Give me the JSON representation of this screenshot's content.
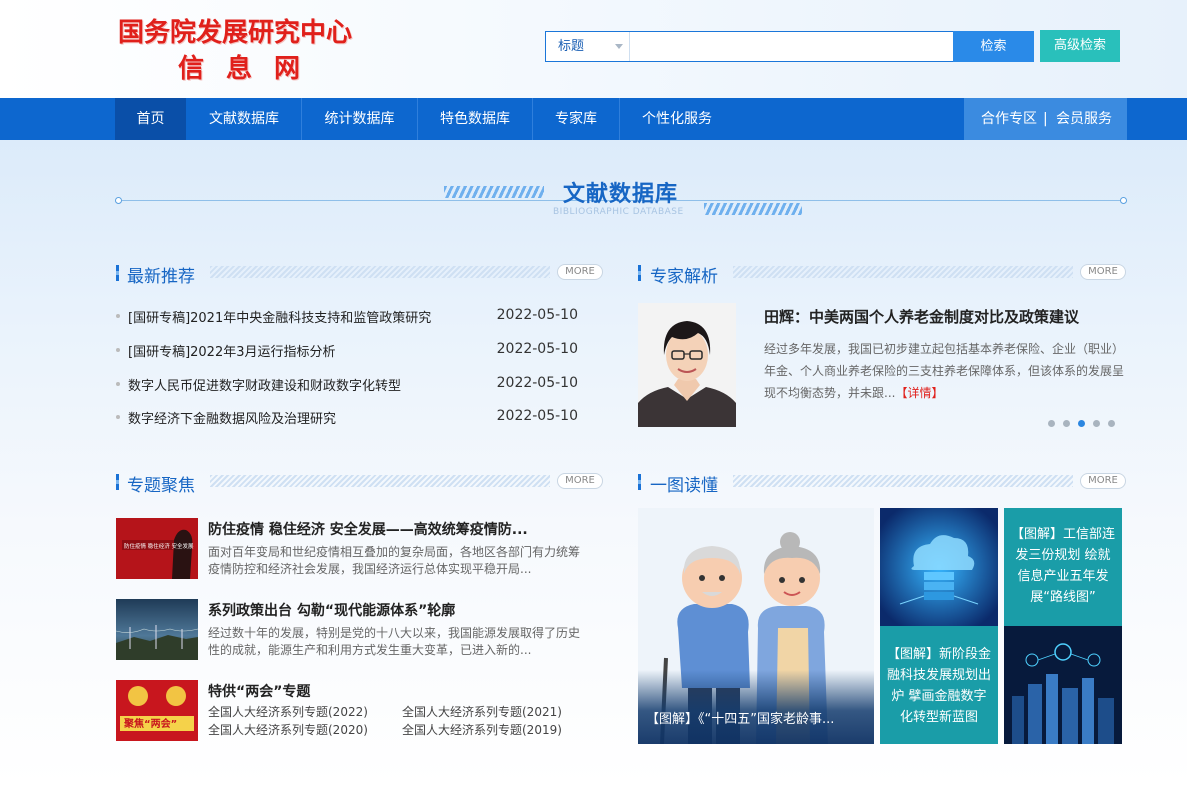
{
  "header": {
    "logo_line1": "国务院发展研究中心",
    "logo_line2": "信息网",
    "search": {
      "field": "标题",
      "placeholder": "",
      "button": "检索"
    },
    "advanced_search": "高级检索"
  },
  "nav": {
    "items": [
      "首页",
      "文献数据库",
      "统计数据库",
      "特色数据库",
      "专家库",
      "个性化服务"
    ],
    "right": [
      "合作专区",
      "会员服务"
    ],
    "divider": "|"
  },
  "section": {
    "title": "文献数据库",
    "subtitle": "BIBLIOGRAPHIC DATABASE"
  },
  "more_label": "MORE",
  "latest": {
    "title": "最新推荐",
    "items": [
      {
        "title": "[国研专稿]2021年中央金融科技支持和监管政策研究",
        "date": "2022-05-10"
      },
      {
        "title": "[国研专稿]2022年3月运行指标分析",
        "date": "2022-05-10"
      },
      {
        "title": "数字人民币促进数字财政建设和财政数字化转型",
        "date": "2022-05-10"
      },
      {
        "title": "数字经济下金融数据风险及治理研究",
        "date": "2022-05-10"
      }
    ]
  },
  "expert": {
    "title": "专家解析",
    "headline": "田辉：中美两国个人养老金制度对比及政策建议",
    "desc": "经过多年发展，我国已初步建立起包括基本养老保险、企业（职业）年金、个人商业养老保险的三支柱养老保障体系，但该体系的发展呈现不均衡态势，并未跟...",
    "detail": "【详情】",
    "active_dot": 3
  },
  "topics": {
    "title": "专题聚焦",
    "items": [
      {
        "title": "防住疫情 稳住经济 安全发展——高效统筹疫情防...",
        "desc": "面对百年变局和世纪疫情相互叠加的复杂局面，各地区各部门有力统筹疫情防控和经济社会发展，我国经济运行总体实现平稳开局..."
      },
      {
        "title": "系列政策出台 勾勒“现代能源体系”轮廓",
        "desc": "经过数十年的发展，特别是党的十八大以来，我国能源发展取得了历史性的成就，能源生产和利用方式发生重大变革，已进入新的..."
      },
      {
        "title": "特供“两会”专题",
        "links": [
          "全国人大经济系列专题(2022)",
          "全国人大经济系列专题(2021)",
          "全国人大经济系列专题(2020)",
          "全国人大经济系列专题(2019)"
        ]
      }
    ],
    "img1_text": "防住疫情 稳住经济 安全发展",
    "img3_text": "聚焦“两会”"
  },
  "infographics": {
    "title": "一图读懂",
    "main_caption": "【图解】《“十四五”国家老龄事...",
    "tile1_text": "【图解】工信部连发三份规划 绘就信息产业五年发展“路线图”",
    "tile2_text": "【图解】新阶段金融科技发展规划出炉 擘画金融数字化转型新蓝图"
  },
  "colors": {
    "nav_blue": "#0d67cf",
    "logo_red": "#e0201b",
    "teal": "#29c0bb",
    "accent_blue": "#1766c4"
  }
}
